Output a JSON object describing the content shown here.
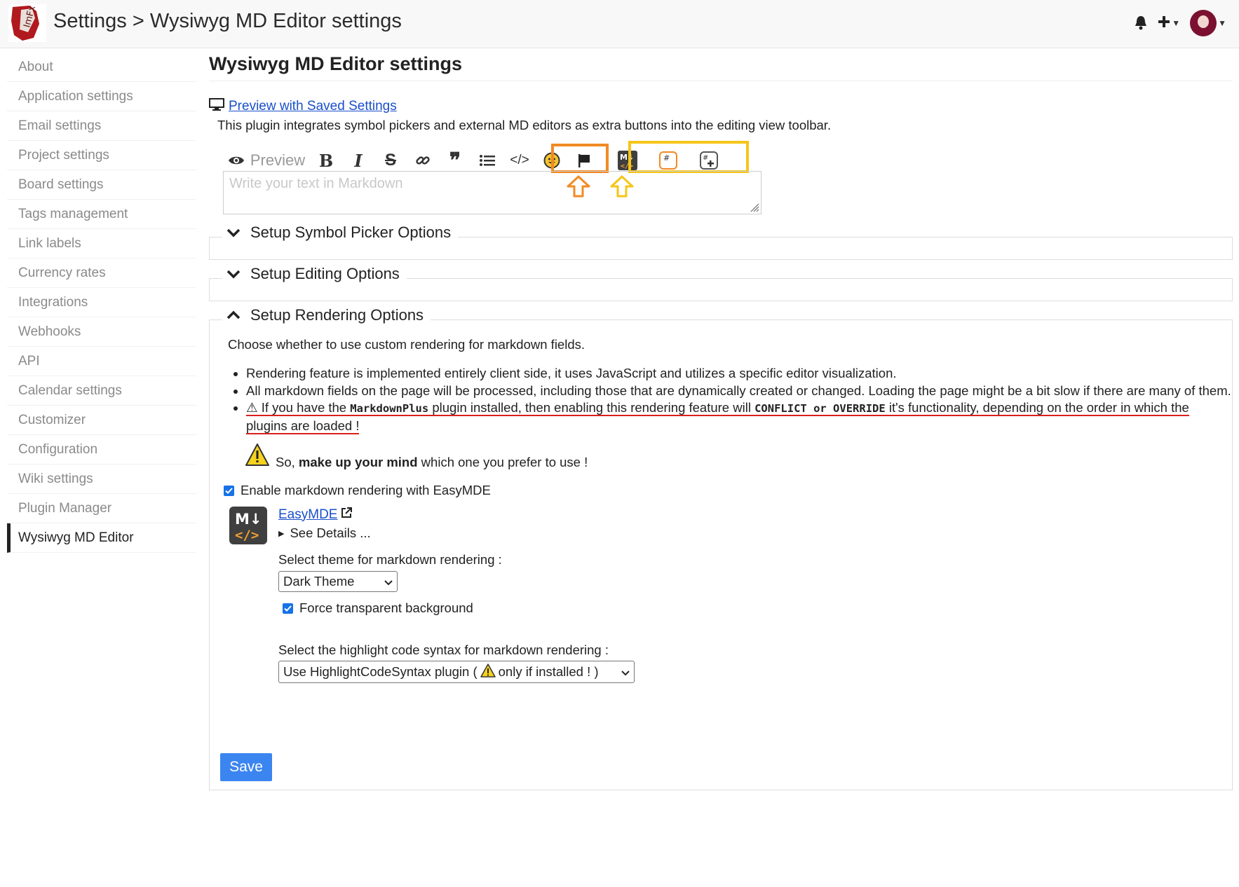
{
  "header": {
    "breadcrumb": "Settings > Wysiwyg MD Editor settings",
    "logo_icon": "redmine-logo",
    "icons": [
      "bell-icon",
      "plus-icon",
      "avatar"
    ]
  },
  "sidebar": {
    "items": [
      {
        "label": "About"
      },
      {
        "label": "Application settings"
      },
      {
        "label": "Email settings"
      },
      {
        "label": "Project settings"
      },
      {
        "label": "Board settings"
      },
      {
        "label": "Tags management"
      },
      {
        "label": "Link labels"
      },
      {
        "label": "Currency rates"
      },
      {
        "label": "Integrations"
      },
      {
        "label": "Webhooks"
      },
      {
        "label": "API"
      },
      {
        "label": "Calendar settings"
      },
      {
        "label": "Customizer"
      },
      {
        "label": "Configuration"
      },
      {
        "label": "Wiki settings"
      },
      {
        "label": "Plugin Manager"
      },
      {
        "label": "Wysiwyg MD Editor"
      }
    ],
    "active_index": 16
  },
  "main": {
    "title": "Wysiwyg MD Editor settings",
    "preview_link": "Preview with Saved Settings",
    "intro": "This plugin integrates symbol pickers and external MD editors as extra buttons into the editing view toolbar.",
    "editor": {
      "preview_label": "Preview",
      "placeholder": "Write your text in Markdown"
    },
    "sections": {
      "symbol": {
        "title": "Setup Symbol Picker Options"
      },
      "editing": {
        "title": "Setup Editing Options"
      },
      "rendering": {
        "title": "Setup Rendering Options",
        "choose_text": "Choose whether to use custom rendering for markdown fields.",
        "bullet1": "Rendering feature is implemented entirely client side, it uses JavaScript and utilizes a specific editor visualization.",
        "bullet2": "All markdown fields on the page will be processed, including those that are dynamically created or changed. Loading the page might be a bit slow if there are many of them.",
        "bullet3_a": "⚠ If you have the ",
        "bullet3_code1": "MarkdownPlus",
        "bullet3_b": " plugin installed, then enabling this rendering feature will ",
        "bullet3_code2": "CONFLICT or OVERRIDE",
        "bullet3_c": " it's functionality, depending on the order in which the plugins are loaded !",
        "mind_a": "So, ",
        "mind_bold": "make up your mind",
        "mind_b": " which one you prefer to use !",
        "enable_label": "Enable markdown rendering with EasyMDE",
        "enable_checked": true,
        "easymde_link": "EasyMDE",
        "see_details": "See Details ...",
        "theme_label": "Select theme for markdown rendering :",
        "theme_value": "Dark Theme",
        "transparent_label": "Force transparent background",
        "transparent_checked": true,
        "highlight_label": "Select the highlight code syntax for markdown rendering :",
        "highlight_value_a": "Use HighlightCodeSyntax plugin ( ",
        "highlight_value_b": " only if installed ! )"
      }
    },
    "save_label": "Save"
  },
  "colors": {
    "link": "#1a4fc9",
    "highlight_orange": "#f28a24",
    "highlight_yellow": "#f5c518",
    "save_button": "#3b85f0",
    "warning_red_underline": "#d9201c",
    "checkbox": "#1672e6"
  }
}
